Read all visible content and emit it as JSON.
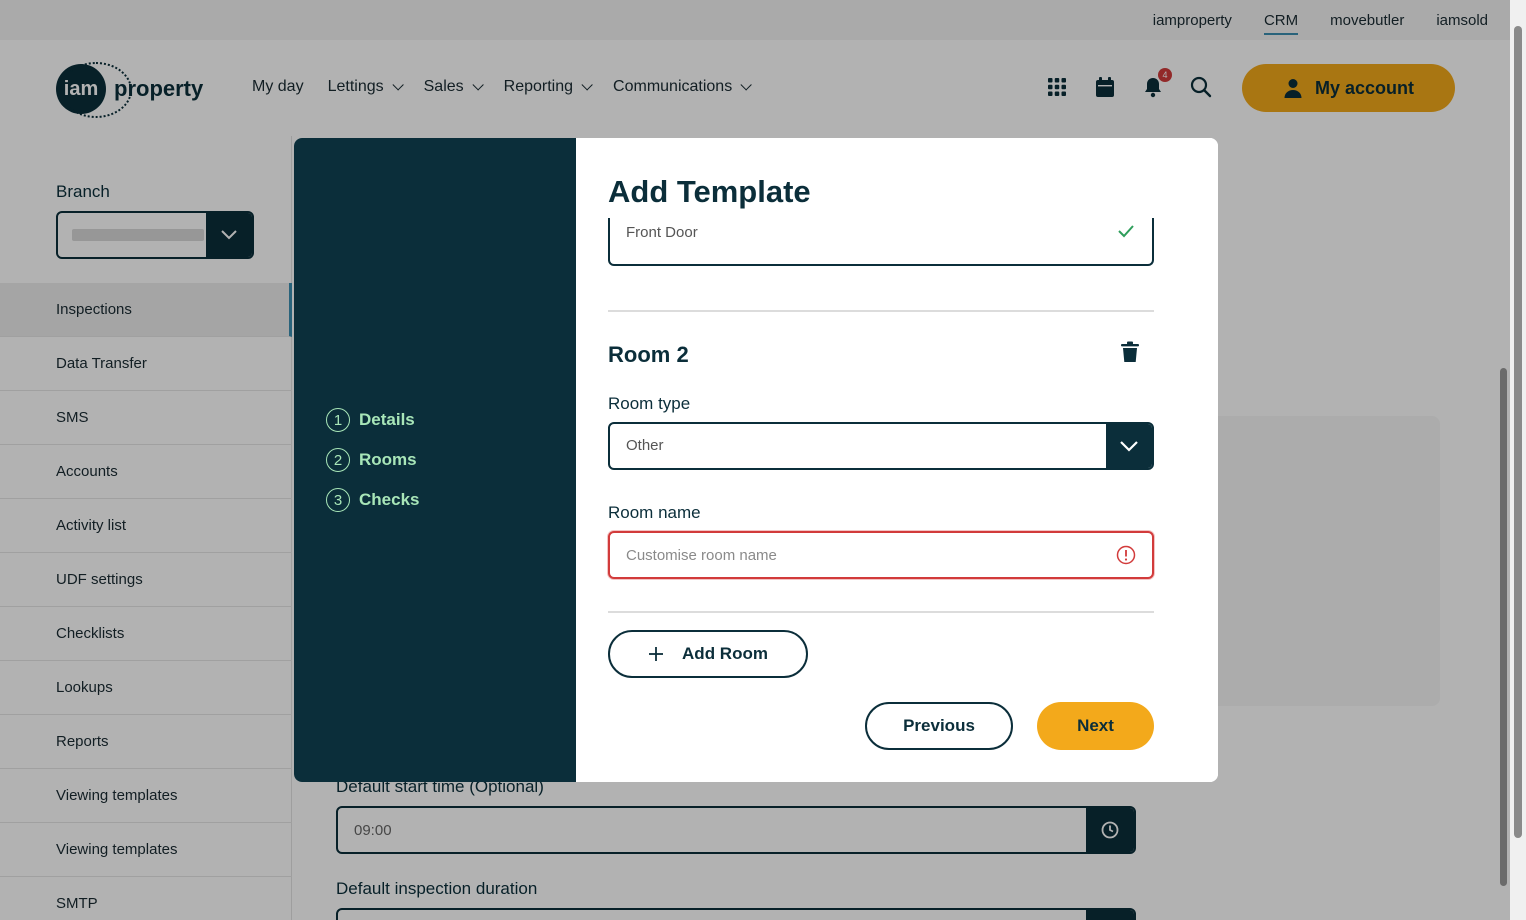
{
  "topbar": {
    "links": [
      {
        "label": "iamproperty",
        "active": false
      },
      {
        "label": "CRM",
        "active": true
      },
      {
        "label": "movebutler",
        "active": false
      },
      {
        "label": "iamsold",
        "active": false
      }
    ]
  },
  "header": {
    "logo_mark": "iam",
    "logo_text": "property",
    "nav": [
      {
        "label": "My day",
        "dropdown": false
      },
      {
        "label": "Lettings",
        "dropdown": true
      },
      {
        "label": "Sales",
        "dropdown": true
      },
      {
        "label": "Reporting",
        "dropdown": true
      },
      {
        "label": "Communications",
        "dropdown": true
      }
    ],
    "icons": [
      "apps-grid-icon",
      "calendar-icon",
      "bell-icon",
      "search-icon"
    ],
    "notification_count": "4",
    "account_label": "My account"
  },
  "sidebar": {
    "branch_label": "Branch",
    "items": [
      {
        "label": "Inspections",
        "active": true
      },
      {
        "label": "Data Transfer",
        "active": false
      },
      {
        "label": "SMS",
        "active": false
      },
      {
        "label": "Accounts",
        "active": false
      },
      {
        "label": "Activity list",
        "active": false
      },
      {
        "label": "UDF settings",
        "active": false
      },
      {
        "label": "Checklists",
        "active": false
      },
      {
        "label": "Lookups",
        "active": false
      },
      {
        "label": "Reports",
        "active": false
      },
      {
        "label": "Viewing templates",
        "active": false
      },
      {
        "label": "Viewing templates",
        "active": false
      },
      {
        "label": "SMTP",
        "active": false
      }
    ]
  },
  "main": {
    "default_start_time_label": "Default start time (Optional)",
    "default_start_time_value": "09:00",
    "default_duration_label": "Default inspection duration"
  },
  "modal": {
    "title": "Add Template",
    "steps": [
      {
        "number": "1",
        "label": "Details"
      },
      {
        "number": "2",
        "label": "Rooms"
      },
      {
        "number": "3",
        "label": "Checks"
      }
    ],
    "previous_room_name": "Front Door",
    "room_heading": "Room 2",
    "room_type_label": "Room type",
    "room_type_value": "Other",
    "room_name_label": "Room name",
    "room_name_placeholder": "Customise room name",
    "add_room_label": "Add Room",
    "previous_label": "Previous",
    "next_label": "Next"
  },
  "colors": {
    "brand_dark": "#0b2e3a",
    "accent_yellow": "#f3a91b",
    "step_green": "#a8e6b8",
    "error_red": "#d23b3b"
  }
}
